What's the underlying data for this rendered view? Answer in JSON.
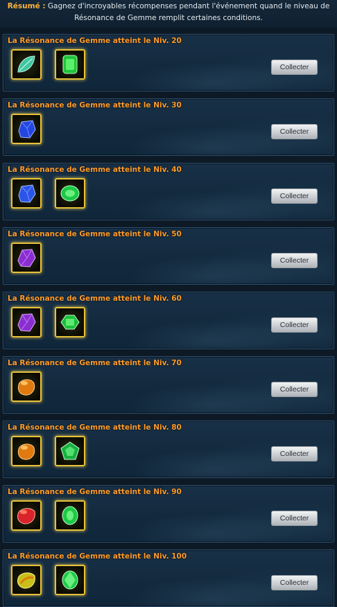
{
  "summary": {
    "label": "Résumé :",
    "line1": "Gagnez d'incroyables récompenses pendant l'événement quand le niveau de",
    "line2": "Résonance de Gemme remplit certaines conditions."
  },
  "colors": {
    "title": "#ff9c2a",
    "frame": "#e8c23a",
    "panel_bg": "#132a3e"
  },
  "rewards": [
    {
      "title": "La Résonance de Gemme atteint le Niv. 20",
      "button": "Collecter",
      "items": [
        "teal-leaf-gem-icon",
        "green-cut-gem-icon"
      ]
    },
    {
      "title": "La Résonance de Gemme atteint le Niv. 30",
      "button": "Collecter",
      "items": [
        "blue-gem-icon"
      ]
    },
    {
      "title": "La Résonance de Gemme atteint le Niv. 40",
      "button": "Collecter",
      "items": [
        "blue-gem-icon",
        "green-oval-gem-icon"
      ]
    },
    {
      "title": "La Résonance de Gemme atteint le Niv. 50",
      "button": "Collecter",
      "items": [
        "purple-gem-icon"
      ]
    },
    {
      "title": "La Résonance de Gemme atteint le Niv. 60",
      "button": "Collecter",
      "items": [
        "purple-gem-icon",
        "green-emerald-gem-icon"
      ]
    },
    {
      "title": "La Résonance de Gemme atteint le Niv. 70",
      "button": "Collecter",
      "items": [
        "orange-gem-icon"
      ]
    },
    {
      "title": "La Résonance de Gemme atteint le Niv. 80",
      "button": "Collecter",
      "items": [
        "orange-gem-icon",
        "green-pentagon-gem-icon"
      ]
    },
    {
      "title": "La Résonance de Gemme atteint le Niv. 90",
      "button": "Collecter",
      "items": [
        "red-gem-icon",
        "green-oval-gem-icon"
      ]
    },
    {
      "title": "La Résonance de Gemme atteint le Niv. 100",
      "button": "Collecter",
      "items": [
        "yellow-green-gem-icon",
        "green-oval-gem-icon"
      ]
    }
  ]
}
